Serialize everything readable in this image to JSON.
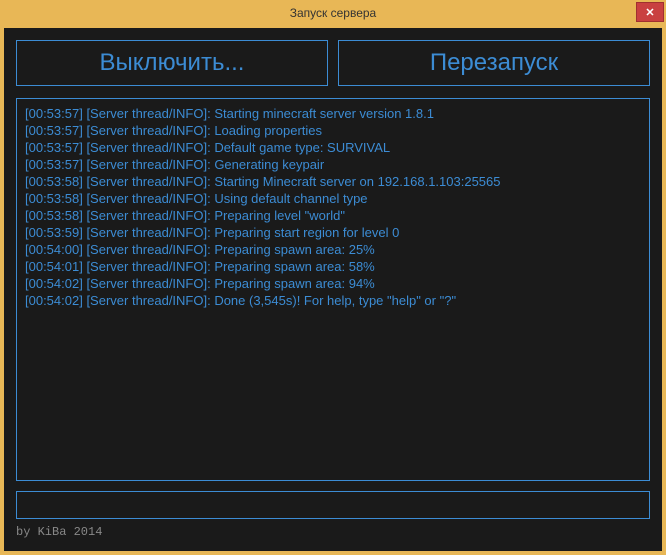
{
  "window": {
    "title": "Запуск сервера",
    "close_label": "✕"
  },
  "buttons": {
    "shutdown": "Выключить...",
    "restart": "Перезапуск"
  },
  "log": [
    "[00:53:57] [Server thread/INFO]: Starting minecraft server version 1.8.1",
    "[00:53:57] [Server thread/INFO]: Loading properties",
    "[00:53:57] [Server thread/INFO]: Default game type: SURVIVAL",
    "[00:53:57] [Server thread/INFO]: Generating keypair",
    "[00:53:58] [Server thread/INFO]: Starting Minecraft server on 192.168.1.103:25565",
    "[00:53:58] [Server thread/INFO]: Using default channel type",
    "[00:53:58] [Server thread/INFO]: Preparing level \"world\"",
    "[00:53:59] [Server thread/INFO]: Preparing start region for level 0",
    "[00:54:00] [Server thread/INFO]: Preparing spawn area: 25%",
    "[00:54:01] [Server thread/INFO]: Preparing spawn area: 58%",
    "[00:54:02] [Server thread/INFO]: Preparing spawn area: 94%",
    "[00:54:02] [Server thread/INFO]: Done (3,545s)! For help, type \"help\" or \"?\""
  ],
  "command_input": {
    "value": "",
    "placeholder": ""
  },
  "footer": "by KiBa 2014",
  "colors": {
    "accent": "#3c8cd4",
    "frame": "#e8b756",
    "bg": "#1a1a1a",
    "close": "#c94040"
  }
}
